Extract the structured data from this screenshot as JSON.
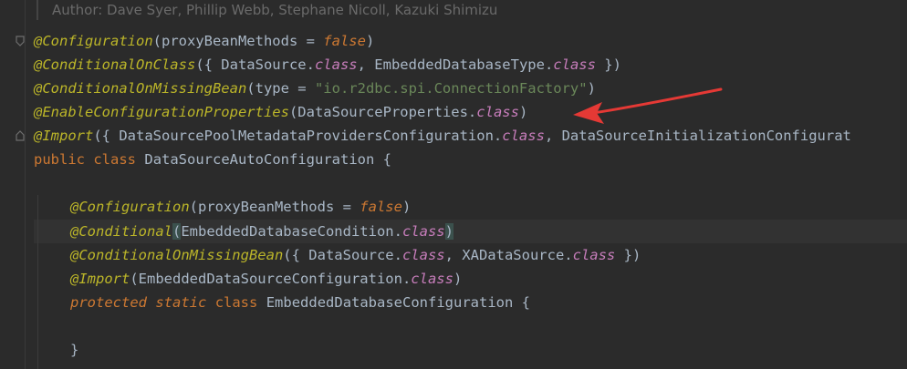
{
  "editor": {
    "author_comment": "Author: Dave Syer, Phillip Webb, Stephane Nicoll, Kazuki Shimizu",
    "colors": {
      "background": "#2b2b2b",
      "annotation": "#bbb529",
      "keyword": "#cc7832",
      "class_keyword": "#c77dbb",
      "string": "#6a8759",
      "text": "#a9b7c6",
      "arrow": "#e53935"
    },
    "lines": {
      "l1": {
        "ann": "@Configuration",
        "p1": "(proxyBeanMethods = ",
        "kw": "false",
        "p2": ")"
      },
      "l2": {
        "ann": "@ConditionalOnClass",
        "p1": "({ DataSource.",
        "k1": "class",
        "p2": ", EmbeddedDatabaseType.",
        "k2": "class",
        "p3": " })"
      },
      "l3": {
        "ann": "@ConditionalOnMissingBean",
        "p1": "(type = ",
        "str": "\"io.r2dbc.spi.ConnectionFactory\"",
        "p2": ")"
      },
      "l4": {
        "ann": "@EnableConfigurationProperties",
        "p1": "(DataSourceProperties.",
        "k1": "class",
        "p2": ")"
      },
      "l5": {
        "ann": "@Import",
        "p1": "({ DataSourcePoolMetadataProvidersConfiguration.",
        "k1": "class",
        "p2": ", DataSourceInitializationConfigurat"
      },
      "l6": {
        "kw1": "public",
        "kw2": "class",
        "name": "DataSourceAutoConfiguration",
        "brace": "{"
      },
      "l7": {
        "ann": "@Configuration",
        "p1": "(proxyBeanMethods = ",
        "kw": "false",
        "p2": ")"
      },
      "l8": {
        "ann": "@Conditional",
        "p0": "(",
        "p1": "EmbeddedDatabaseCondition.",
        "k1": "class",
        "p2": ")"
      },
      "l9": {
        "ann": "@ConditionalOnMissingBean",
        "p1": "({ DataSource.",
        "k1": "class",
        "p2": ", XADataSource.",
        "k2": "class",
        "p3": " })"
      },
      "l10": {
        "ann": "@Import",
        "p1": "(EmbeddedDataSourceConfiguration.",
        "k1": "class",
        "p2": ")"
      },
      "l11": {
        "kw1": "protected",
        "kw2": "static",
        "kw3": "class",
        "name": "EmbeddedDatabaseConfiguration",
        "brace": "{"
      },
      "l12": {
        "brace": "}"
      }
    }
  }
}
